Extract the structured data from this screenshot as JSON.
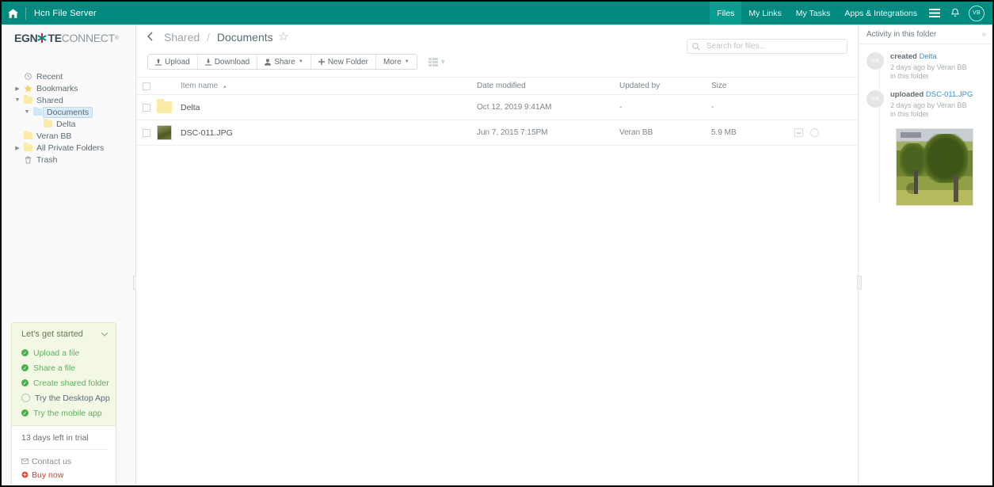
{
  "topbar": {
    "home_icon": "home-icon",
    "title": "Hcn File Server",
    "nav": [
      {
        "label": "Files",
        "active": true
      },
      {
        "label": "My Links",
        "active": false
      },
      {
        "label": "My Tasks",
        "active": false
      },
      {
        "label": "Apps & Integrations",
        "active": false
      }
    ],
    "menu_icon": "hamburger-icon",
    "bell_icon": "bell-icon",
    "avatar_initials": "VB",
    "background_color": "#008a80"
  },
  "sidebar": {
    "logo": {
      "part1": "EGN",
      "part2": "TE",
      "part3": "CONNECT",
      "tm": "®"
    },
    "tree": [
      {
        "label": "Recent",
        "icon": "clock-icon",
        "arrow": "",
        "indent": 0,
        "selected": false
      },
      {
        "label": "Bookmarks",
        "icon": "star-icon",
        "arrow": "▶",
        "indent": 0,
        "selected": false
      },
      {
        "label": "Shared",
        "icon": "folder-icon",
        "arrow": "▼",
        "indent": 0,
        "selected": false
      },
      {
        "label": "Documents",
        "icon": "folder-icon-blue",
        "arrow": "▼",
        "indent": 1,
        "selected": true
      },
      {
        "label": "Delta",
        "icon": "folder-icon",
        "arrow": "",
        "indent": 2,
        "selected": false
      },
      {
        "label": "Veran BB",
        "icon": "folder-icon",
        "arrow": "",
        "indent": 0,
        "selected": false
      },
      {
        "label": "All Private Folders",
        "icon": "folder-icon",
        "arrow": "▶",
        "indent": 0,
        "selected": false
      },
      {
        "label": "Trash",
        "icon": "trash-icon",
        "arrow": "",
        "indent": 0,
        "selected": false
      }
    ],
    "get_started": {
      "title": "Let's get started",
      "chevron": "⌄",
      "items": [
        {
          "label": "Upload a file",
          "done": true
        },
        {
          "label": "Share a file",
          "done": true
        },
        {
          "label": "Create shared folder",
          "done": true
        },
        {
          "label": "Try the Desktop App",
          "done": false
        },
        {
          "label": "Try the mobile app",
          "done": true
        }
      ]
    },
    "trial": {
      "days_text": "13 days left in trial",
      "contact_label": "Contact us",
      "contact_icon": "envelope-icon",
      "buy_label": "Buy now",
      "buy_icon": "cart-icon",
      "buy_color": "#d0432f"
    }
  },
  "main": {
    "back_icon": "chevron-left-icon",
    "breadcrumb": {
      "parent": "Shared",
      "separator": "/",
      "current": "Documents",
      "star_icon": "star-outline-icon"
    },
    "toolbar": [
      {
        "label": "Upload",
        "icon": "upload-icon",
        "caret": false
      },
      {
        "label": "Download",
        "icon": "download-icon",
        "caret": false
      },
      {
        "label": "Share",
        "icon": "person-icon",
        "caret": true
      },
      {
        "label": "New Folder",
        "icon": "plus-icon",
        "caret": false
      },
      {
        "label": "More",
        "icon": "",
        "caret": true
      }
    ],
    "view_toggle": {
      "icon": "list-view-icon",
      "caret": "▾"
    },
    "search": {
      "placeholder": "Search for files...",
      "value": "",
      "icon": "search-icon"
    },
    "table": {
      "columns": [
        "Item name",
        "Date modified",
        "Updated by",
        "Size"
      ],
      "sort_indicator": "▴",
      "rows": [
        {
          "name": "Delta",
          "icon": "folder-icon",
          "date_modified": "Oct 12, 2019 9:41AM",
          "updated_by": "-",
          "size": "-",
          "actions": []
        },
        {
          "name": "DSC-011.JPG",
          "icon": "image-thumbnail",
          "date_modified": "Jun 7, 2015 7:15PM",
          "updated_by": "Veran BB",
          "size": "5.9 MB",
          "actions": [
            "note-icon",
            "comment-count-0"
          ]
        }
      ]
    }
  },
  "activity": {
    "title": "Activity in this folder",
    "collapse_icon": "»",
    "items": [
      {
        "avatar": "VB",
        "action": "created",
        "target": "Delta",
        "meta": "2 days ago by Veran BB in this folder",
        "thumbnail": false
      },
      {
        "avatar": "VB",
        "action": "uploaded",
        "target": "DSC-011.JPG",
        "meta": "2 days ago by Veran BB in this folder",
        "thumbnail": true
      }
    ],
    "link_color": "#3b8fcf"
  }
}
